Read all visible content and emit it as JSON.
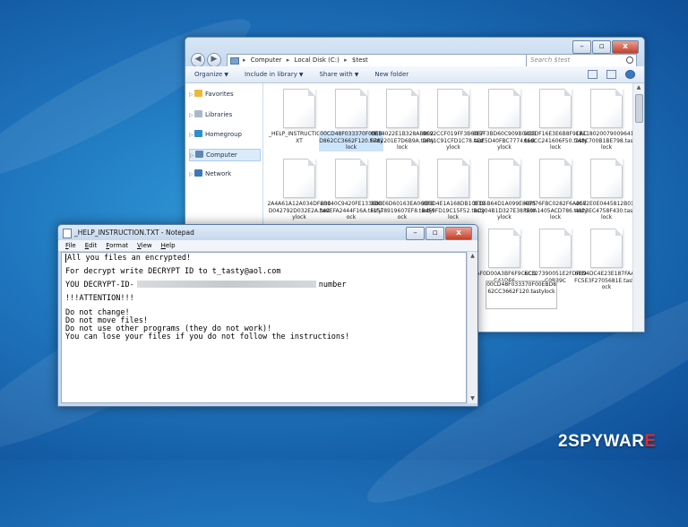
{
  "explorer": {
    "breadcrumb": [
      "Computer",
      "Local Disk (C:)",
      "$test"
    ],
    "search_placeholder": "Search $test",
    "toolbar": {
      "organize": "Organize",
      "include": "Include in library",
      "share": "Share with",
      "new_folder": "New folder"
    },
    "nav": [
      {
        "label": "Favorites",
        "icon": "star-icon"
      },
      {
        "label": "Libraries",
        "icon": "library-icon"
      },
      {
        "label": "Homegroup",
        "icon": "homegroup-icon"
      },
      {
        "label": "Computer",
        "icon": "computer-icon",
        "selected": true
      },
      {
        "label": "Network",
        "icon": "network-icon"
      }
    ],
    "files": [
      "_HELP_INSTRUCTION.TXT",
      "00CD48F033370F00EBD862CC3662F120.tastylock",
      "0B14022E1B328AB862F762201E7D6B9A.tastylock",
      "0C92CCF019FF3B60BFDF41C91CFD1C78.tastylock",
      "0E7F3BD60C909B048B4DE5D40FBC7774.tastylock",
      "1C1DF16E3E6B8F9CAC666CC241606F50.tastylock",
      "1E1180200790096418748C700B1BE798.tastylock",
      "2A4A61A12A034DF6D0D042792D032E2A.tastylock",
      "2B140C9420FE1336B8349EFA2444F16A.tastylock",
      "3DCE6D60163EA060FBF1578919607EF8.tastylock",
      "3EBD4E1A168DB10E39B4F9FD19C15F52.tastylock",
      "3FD5B64D1A099E8075BC204B1D327E38.tastylock",
      "4B076FBC0282F6A267FE9A1405ACD786.tastylock",
      "4C82E0E0445812B01E4923EC4758F430.tastylock",
      "",
      "",
      "",
      "6AF0D00A3BF6F9CECDC41DF6",
      "6C327390051E2FDFB9C0B39C",
      "6ED4DC4E23E187FAA5FC5E3F2705681E.tastylock"
    ],
    "selected_file": "00CD48F033370F00EBD862CC3662F120.tastylock"
  },
  "notepad": {
    "title": "_HELP_INSTRUCTION.TXT - Notepad",
    "menu": [
      "File",
      "Edit",
      "Format",
      "View",
      "Help"
    ],
    "lines": {
      "l1": "All you files an encrypted!",
      "l2": "For decrypt write DECRYPT ID to t_tasty@aol.com",
      "l3a": "YOU DECRYPT-ID-",
      "l3b": "number",
      "l4": "!!!ATTENTION!!!",
      "l5": "Do not change!",
      "l6": "Do not move files!",
      "l7": "Do not use other programs (they do not work)!",
      "l8": "You can lose your files if you do not follow the instructions!"
    }
  },
  "watermark": {
    "prefix": "2SPYWAR",
    "suffix": "E"
  }
}
